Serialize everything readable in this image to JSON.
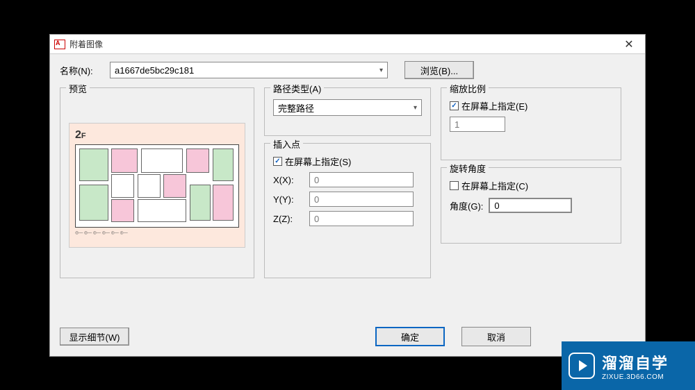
{
  "titlebar": {
    "title": "附着图像"
  },
  "name": {
    "label": "名称(N):",
    "value": "a1667de5bc29c181",
    "browse": "浏览(B)..."
  },
  "preview": {
    "title": "预览",
    "floor_label": "2",
    "floor_suffix": "F"
  },
  "path_type": {
    "title": "路径类型(A)",
    "value": "完整路径"
  },
  "insert_point": {
    "title": "插入点",
    "specify_onscreen": "在屏幕上指定(S)",
    "specify_checked": true,
    "x_label": "X(X):",
    "x_value": "0",
    "y_label": "Y(Y):",
    "y_value": "0",
    "z_label": "Z(Z):",
    "z_value": "0"
  },
  "scale": {
    "title": "缩放比例",
    "specify_onscreen": "在屏幕上指定(E)",
    "specify_checked": true,
    "value": "1"
  },
  "rotation": {
    "title": "旋转角度",
    "specify_onscreen": "在屏幕上指定(C)",
    "specify_checked": false,
    "angle_label": "角度(G):",
    "angle_value": "0"
  },
  "bottom": {
    "details": "显示细节(W)",
    "ok": "确定",
    "cancel": "取消"
  },
  "watermark": {
    "main": "溜溜自学",
    "sub": "ZIXUE.3D66.COM"
  }
}
